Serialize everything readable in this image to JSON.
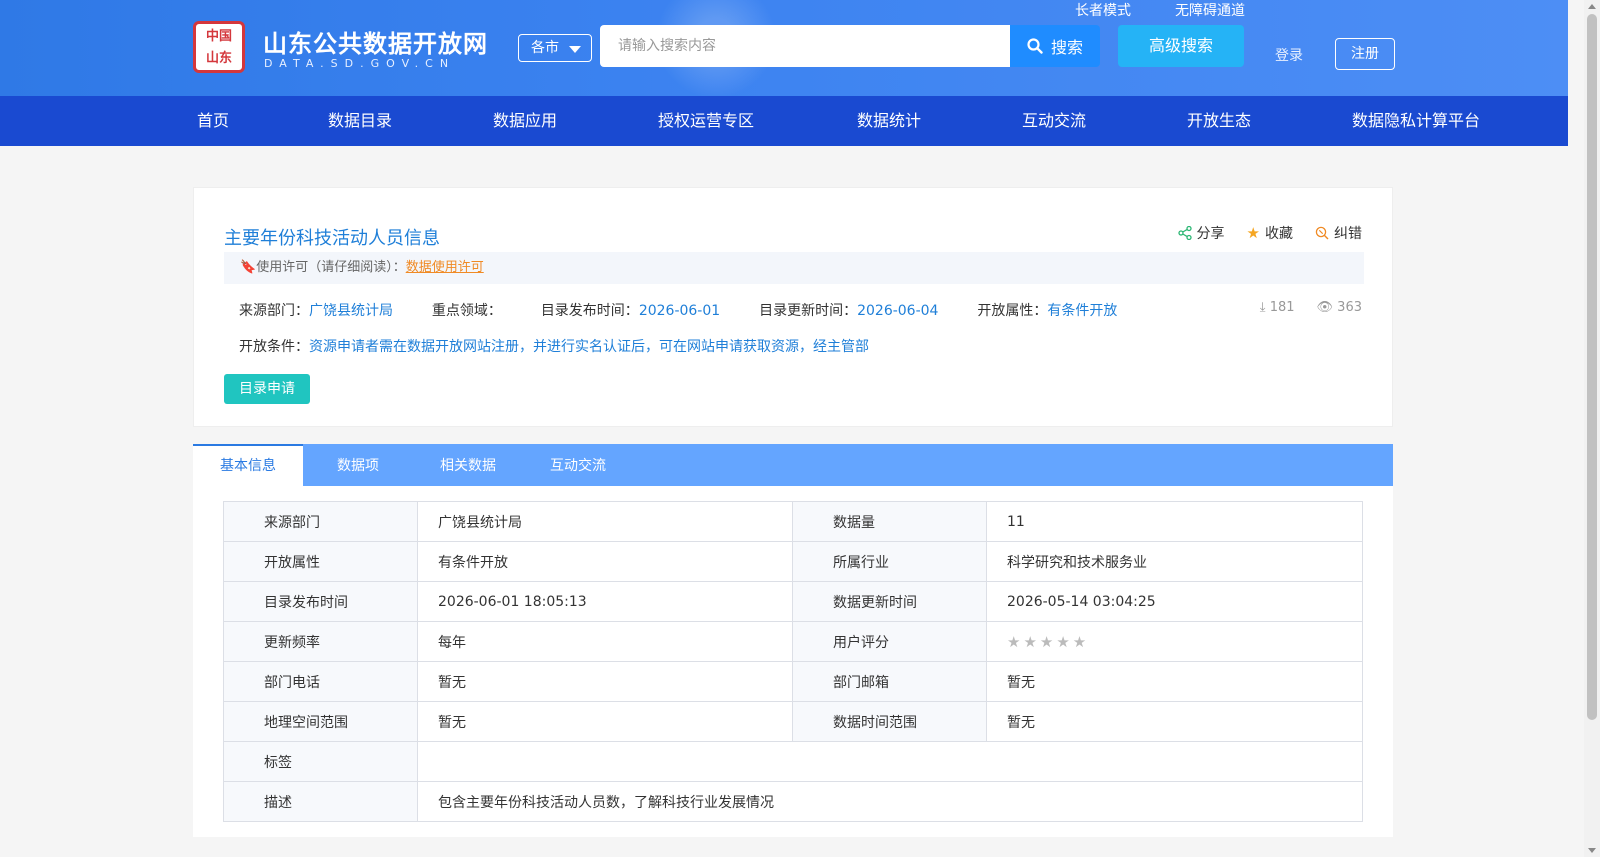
{
  "header": {
    "logo_seal": [
      "中国",
      "山东"
    ],
    "title": "山东公共数据开放网",
    "subtitle": "DATA.SD.GOV.CN",
    "city_select": "各市",
    "search_placeholder": "请输入搜索内容",
    "search_button": "搜索",
    "advanced_search": "高级搜索",
    "elder_mode": "长者模式",
    "accessibility": "无障碍通道",
    "login": "登录",
    "register": "注册"
  },
  "nav": {
    "items": [
      "首页",
      "数据目录",
      "数据应用",
      "授权运营专区",
      "数据统计",
      "互动交流",
      "开放生态",
      "数据隐私计算平台"
    ]
  },
  "dataset": {
    "title": "主要年份科技活动人员信息",
    "actions": {
      "share": "分享",
      "favorite": "收藏",
      "report": "纠错"
    },
    "license_label": "使用许可（请仔细阅读）：",
    "license_link": "数据使用许可",
    "source_label": "来源部门：",
    "source_value": "广饶县统计局",
    "domain_label": "重点领域：",
    "publish_label": "目录发布时间：",
    "publish_value": "2026-06-01",
    "update_label": "目录更新时间：",
    "update_value": "2026-06-04",
    "open_label": "开放属性：",
    "open_value": "有条件开放",
    "downloads": "181",
    "views": "363",
    "condition_label": "开放条件：",
    "condition_value": "资源申请者需在数据开放网站注册，并进行实名认证后，可在网站申请获取资源，经主管部",
    "apply_button": "目录申请"
  },
  "tabs": [
    "基本信息",
    "数据项",
    "相关数据",
    "互动交流"
  ],
  "info": {
    "rows": [
      {
        "k1": "来源部门",
        "v1": "广饶县统计局",
        "k2": "数据量",
        "v2": "11"
      },
      {
        "k1": "开放属性",
        "v1": "有条件开放",
        "k2": "所属行业",
        "v2": "科学研究和技术服务业"
      },
      {
        "k1": "目录发布时间",
        "v1": "2026-06-01 18:05:13",
        "k2": "数据更新时间",
        "v2": "2026-05-14 03:04:25"
      },
      {
        "k1": "更新频率",
        "v1": "每年",
        "k2": "用户评分",
        "v2": ""
      },
      {
        "k1": "部门电话",
        "v1": "暂无",
        "k2": "部门邮箱",
        "v2": "暂无"
      },
      {
        "k1": "地理空间范围",
        "v1": "暂无",
        "k2": "数据时间范围",
        "v2": "暂无"
      }
    ],
    "tags_label": "标签",
    "tags_value": "",
    "desc_label": "描述",
    "desc_value": "包含主要年份科技活动人员数，了解科技行业发展情况",
    "rating_stars": "★★★★★",
    "rating_value": 0
  },
  "colors": {
    "header_blue": "#3b82f0",
    "nav_blue": "#1a4ad1",
    "link_blue": "#1f7fd8",
    "tab_bar": "#64a5ff",
    "apply_teal": "#20c5c0",
    "license_orange": "#f08a24"
  }
}
